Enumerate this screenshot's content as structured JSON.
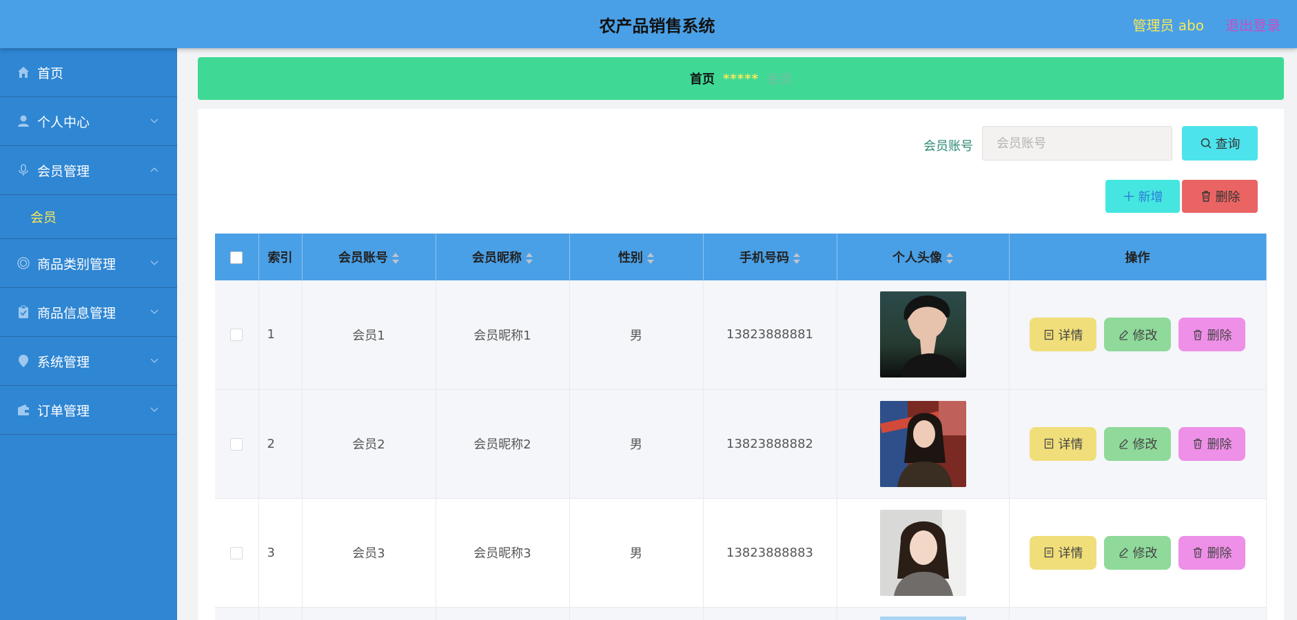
{
  "header": {
    "title": "农产品销售系统",
    "admin": "管理员 abo",
    "logout": "退出登录"
  },
  "sidebar": {
    "items": [
      {
        "label": "首页",
        "icon": "home-icon"
      },
      {
        "label": "个人中心",
        "icon": "user-icon"
      },
      {
        "label": "会员管理",
        "icon": "microphone-icon",
        "expanded": true
      },
      {
        "label": "会员",
        "sub": true
      },
      {
        "label": "商品类别管理",
        "icon": "circle-icon"
      },
      {
        "label": "商品信息管理",
        "icon": "clipboard-icon"
      },
      {
        "label": "系统管理",
        "icon": "location-icon"
      },
      {
        "label": "订单管理",
        "icon": "wallet-icon"
      }
    ]
  },
  "breadcrumb": {
    "home": "首页",
    "separator": "*****",
    "current": "会员"
  },
  "search": {
    "label": "会员账号",
    "placeholder": "会员账号",
    "query_label": "查询"
  },
  "toolbar": {
    "add_label": "新增",
    "delete_label": "删除"
  },
  "table": {
    "headers": [
      "索引",
      "会员账号",
      "会员昵称",
      "性别",
      "手机号码",
      "个人头像",
      "操作"
    ],
    "rows": [
      {
        "index": "1",
        "account": "会员1",
        "nickname": "会员昵称1",
        "gender": "男",
        "phone": "13823888881"
      },
      {
        "index": "2",
        "account": "会员2",
        "nickname": "会员昵称2",
        "gender": "男",
        "phone": "13823888882"
      },
      {
        "index": "3",
        "account": "会员3",
        "nickname": "会员昵称3",
        "gender": "男",
        "phone": "13823888883"
      }
    ],
    "ops": {
      "detail": "详情",
      "edit": "修改",
      "delete": "删除"
    }
  },
  "colors": {
    "header_bg": "#4aa0e6",
    "sidebar_bg": "#2f86d3",
    "breadcrumb_bg": "#3fd995",
    "accent_yellow": "#f7e85a"
  }
}
